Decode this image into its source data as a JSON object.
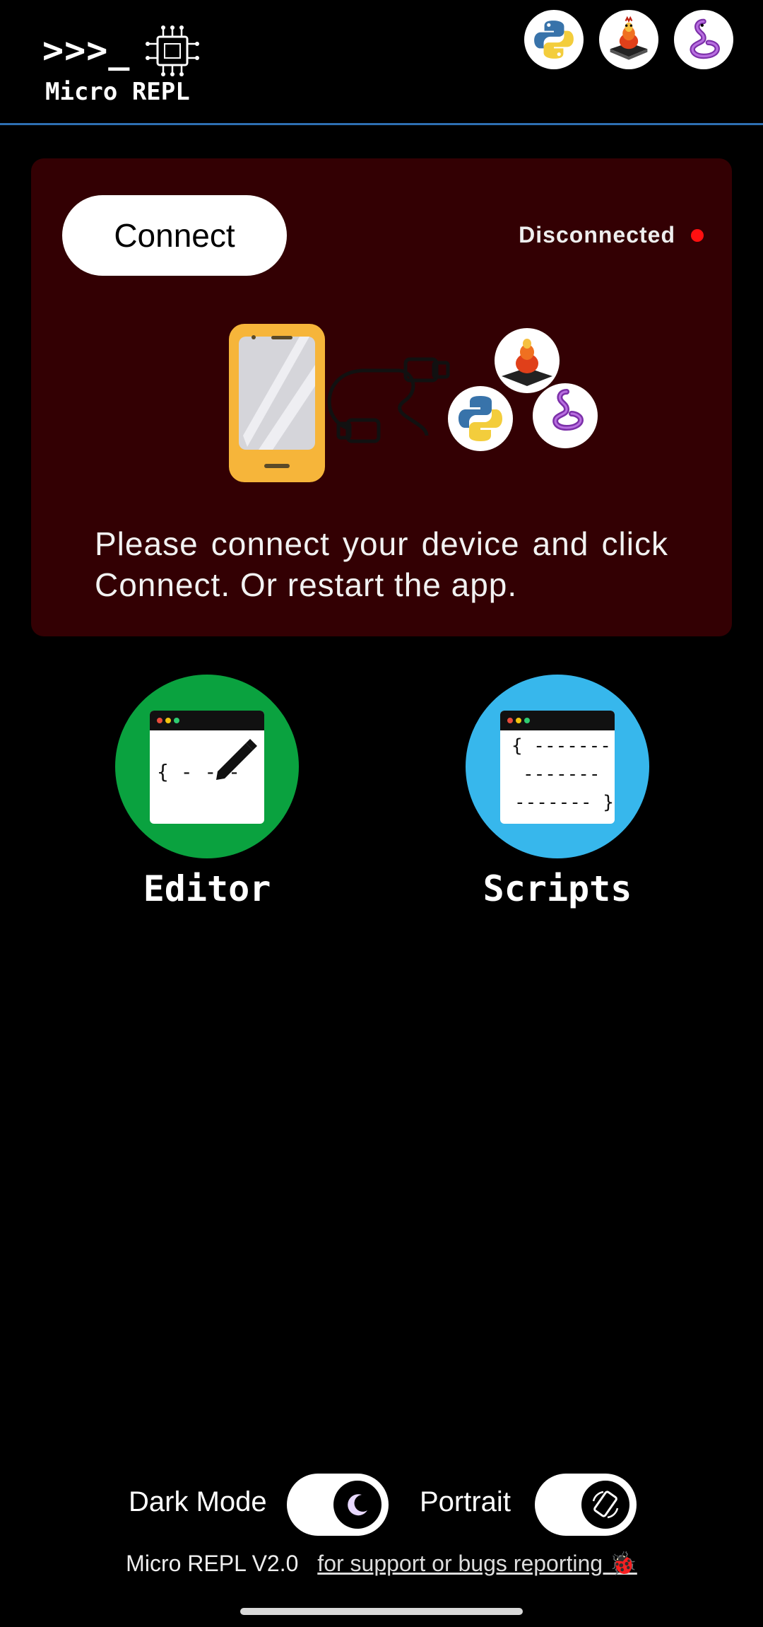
{
  "header": {
    "logo_prompt": ">>>_",
    "logo_title": "Micro REPL",
    "badges": [
      "python-logo-icon",
      "raspberry-pi-board-icon",
      "circuitpython-snake-icon"
    ]
  },
  "card": {
    "connect_label": "Connect",
    "status_text": "Disconnected",
    "status_color": "#ff1010",
    "message": "Please connect your device and click Connect. Or restart the app."
  },
  "tiles": [
    {
      "label": "Editor",
      "color": "#0aa23f",
      "icon": "code-editor-icon"
    },
    {
      "label": "Scripts",
      "color": "#37b7ec",
      "icon": "scripts-file-icon"
    }
  ],
  "settings": {
    "dark_mode_label": "Dark Mode",
    "dark_mode_on": true,
    "portrait_label": "Portrait",
    "portrait_on": true
  },
  "footer": {
    "version": "Micro REPL V2.0",
    "support_link": "for support or bugs reporting 🐞"
  }
}
